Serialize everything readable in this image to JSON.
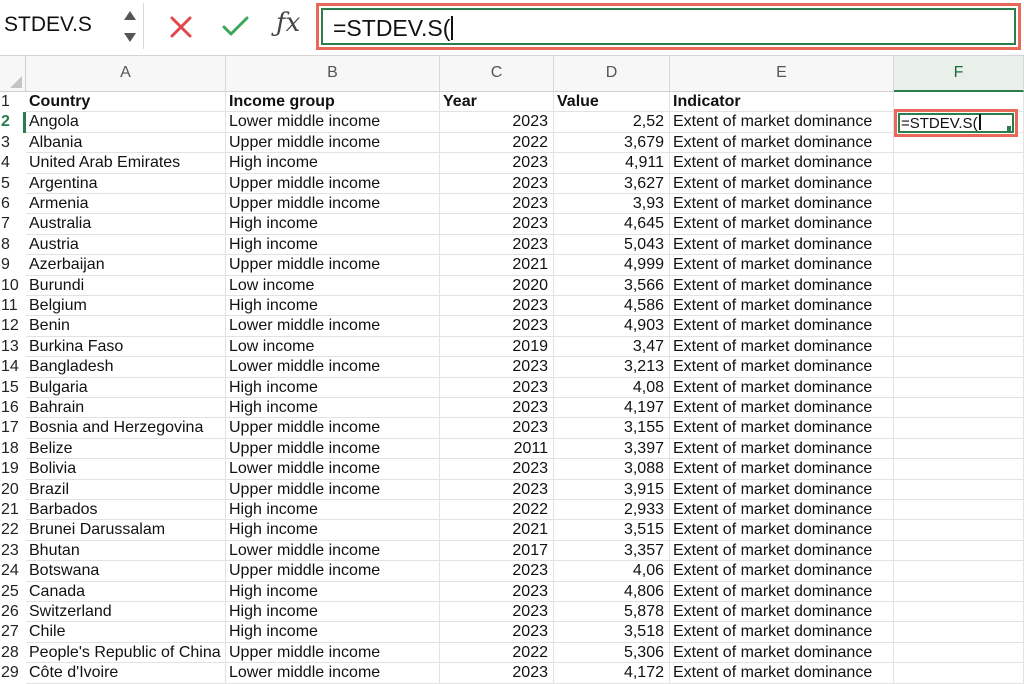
{
  "name_box": {
    "value": "STDEV.S"
  },
  "formula_bar": {
    "value": "=STDEV.S("
  },
  "active_cell": {
    "ref": "F2",
    "value": "=STDEV.S("
  },
  "columns": [
    "A",
    "B",
    "C",
    "D",
    "E",
    "F"
  ],
  "active_column": "F",
  "headers": {
    "country": "Country",
    "income": "Income group",
    "year": "Year",
    "value": "Value",
    "indicator": "Indicator"
  },
  "rows": [
    [
      "Angola",
      "Lower middle income",
      "2023",
      "2,52",
      "Extent of market dominance"
    ],
    [
      "Albania",
      "Upper middle income",
      "2022",
      "3,679",
      "Extent of market dominance"
    ],
    [
      "United Arab Emirates",
      "High income",
      "2023",
      "4,911",
      "Extent of market dominance"
    ],
    [
      "Argentina",
      "Upper middle income",
      "2023",
      "3,627",
      "Extent of market dominance"
    ],
    [
      "Armenia",
      "Upper middle income",
      "2023",
      "3,93",
      "Extent of market dominance"
    ],
    [
      "Australia",
      "High income",
      "2023",
      "4,645",
      "Extent of market dominance"
    ],
    [
      "Austria",
      "High income",
      "2023",
      "5,043",
      "Extent of market dominance"
    ],
    [
      "Azerbaijan",
      "Upper middle income",
      "2021",
      "4,999",
      "Extent of market dominance"
    ],
    [
      "Burundi",
      "Low income",
      "2020",
      "3,566",
      "Extent of market dominance"
    ],
    [
      "Belgium",
      "High income",
      "2023",
      "4,586",
      "Extent of market dominance"
    ],
    [
      "Benin",
      "Lower middle income",
      "2023",
      "4,903",
      "Extent of market dominance"
    ],
    [
      "Burkina Faso",
      "Low income",
      "2019",
      "3,47",
      "Extent of market dominance"
    ],
    [
      "Bangladesh",
      "Lower middle income",
      "2023",
      "3,213",
      "Extent of market dominance"
    ],
    [
      "Bulgaria",
      "High income",
      "2023",
      "4,08",
      "Extent of market dominance"
    ],
    [
      "Bahrain",
      "High income",
      "2023",
      "4,197",
      "Extent of market dominance"
    ],
    [
      "Bosnia and Herzegovina",
      "Upper middle income",
      "2023",
      "3,155",
      "Extent of market dominance"
    ],
    [
      "Belize",
      "Upper middle income",
      "2011",
      "3,397",
      "Extent of market dominance"
    ],
    [
      "Bolivia",
      "Lower middle income",
      "2023",
      "3,088",
      "Extent of market dominance"
    ],
    [
      "Brazil",
      "Upper middle income",
      "2023",
      "3,915",
      "Extent of market dominance"
    ],
    [
      "Barbados",
      "High income",
      "2022",
      "2,933",
      "Extent of market dominance"
    ],
    [
      "Brunei Darussalam",
      "High income",
      "2021",
      "3,515",
      "Extent of market dominance"
    ],
    [
      "Bhutan",
      "Lower middle income",
      "2017",
      "3,357",
      "Extent of market dominance"
    ],
    [
      "Botswana",
      "Upper middle income",
      "2023",
      "4,06",
      "Extent of market dominance"
    ],
    [
      "Canada",
      "High income",
      "2023",
      "4,806",
      "Extent of market dominance"
    ],
    [
      "Switzerland",
      "High income",
      "2023",
      "5,878",
      "Extent of market dominance"
    ],
    [
      "Chile",
      "High income",
      "2023",
      "3,518",
      "Extent of market dominance"
    ],
    [
      "People's Republic of China",
      "Upper middle income",
      "2022",
      "5,306",
      "Extent of market dominance"
    ],
    [
      "Côte d'Ivoire",
      "Lower middle income",
      "2023",
      "4,172",
      "Extent of market dominance"
    ]
  ],
  "row_numbers": [
    "1",
    "2",
    "3",
    "4",
    "5",
    "6",
    "7",
    "8",
    "9",
    "10",
    "11",
    "12",
    "13",
    "14",
    "15",
    "16",
    "17",
    "18",
    "19",
    "20",
    "21",
    "22",
    "23",
    "24",
    "25",
    "26",
    "27",
    "28",
    "29"
  ],
  "colors": {
    "accent_green": "#2b7d4e",
    "highlight_red": "#e8685a",
    "cancel_red": "#e0484b",
    "confirm_green": "#3ea65a"
  },
  "icons": {
    "cancel": "cancel-x-icon",
    "confirm": "confirm-check-icon",
    "function": "fx-function-icon"
  }
}
